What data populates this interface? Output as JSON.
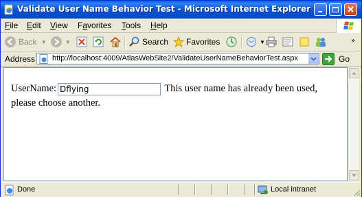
{
  "window": {
    "title": "Validate User Name Behavior Test - Microsoft Internet Explorer"
  },
  "menu": {
    "items": [
      {
        "label": "File",
        "accel": "F",
        "rest": "ile"
      },
      {
        "label": "Edit",
        "accel": "E",
        "rest": "dit"
      },
      {
        "label": "View",
        "accel": "V",
        "rest": "iew"
      },
      {
        "label": "Favorites",
        "accel": "a",
        "pre": "F",
        "rest": "vorites"
      },
      {
        "label": "Tools",
        "accel": "T",
        "rest": "ools"
      },
      {
        "label": "Help",
        "accel": "H",
        "rest": "elp"
      }
    ]
  },
  "toolbar": {
    "back_label": "Back",
    "search_label": "Search",
    "favorites_label": "Favorites"
  },
  "address": {
    "label": "Address",
    "url": "http://localhost:4009/AtlasWebSite2/ValidateUserNameBehaviorTest.aspx",
    "go_label": "Go"
  },
  "page": {
    "username_label": "UserName:",
    "username_value": "Dflying",
    "message_line1": "This user name has already been used,",
    "message_line2": "please choose another."
  },
  "status": {
    "text": "Done",
    "zone": "Local intranet"
  },
  "colors": {
    "titlebar": "#0857d6",
    "chrome": "#ece9d8",
    "address_border": "#7f9db9"
  }
}
